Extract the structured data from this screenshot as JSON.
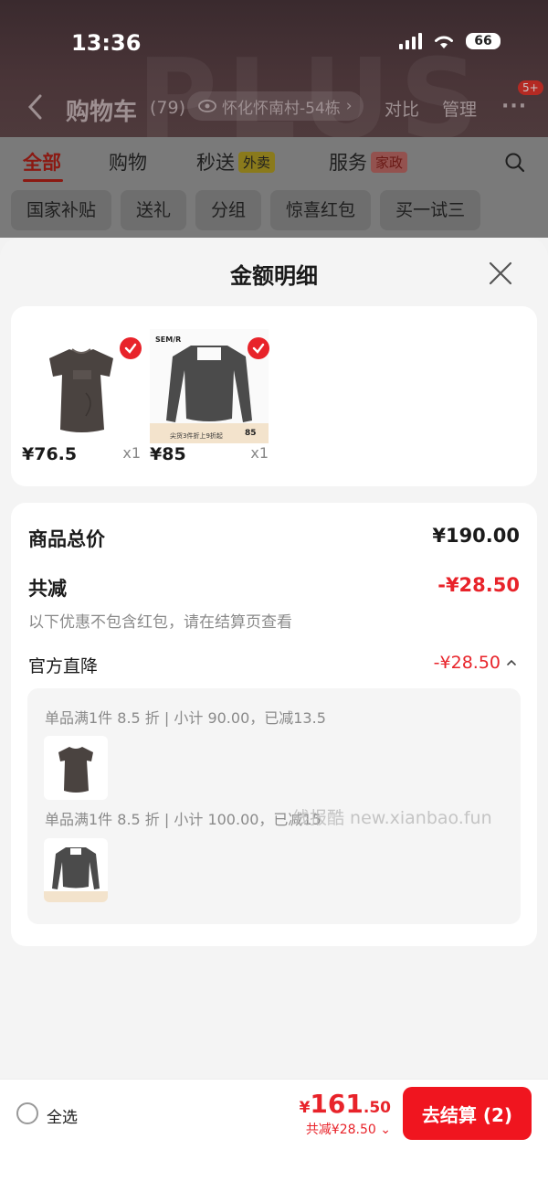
{
  "status_bar": {
    "time": "13:36",
    "battery": "66"
  },
  "header": {
    "title": "购物车",
    "count": "(79)",
    "location": "怀化怀南村-54栋",
    "compare": "对比",
    "manage": "管理",
    "badge": "5+"
  },
  "tabs": [
    {
      "label": "全部"
    },
    {
      "label": "购物"
    },
    {
      "label": "秒送",
      "tag": "外卖"
    },
    {
      "label": "服务",
      "tag": "家政"
    }
  ],
  "filters": [
    "国家补贴",
    "送礼",
    "分组",
    "惊喜红包",
    "买一试三"
  ],
  "sheet": {
    "title": "金额明细",
    "products": [
      {
        "price": "¥76.5",
        "qty": "x1",
        "brand": ""
      },
      {
        "price": "¥85",
        "qty": "x1",
        "brand": "SEM/R",
        "banner_text": "尖货3件折上9折起",
        "banner_price": "85"
      }
    ],
    "subtotal_label": "商品总价",
    "subtotal_value": "¥190.00",
    "discount_label": "共减",
    "discount_value": "-¥28.50",
    "discount_note": "以下优惠不包含红包，请在结算页查看",
    "official_label": "官方直降",
    "official_value": "-¥28.50",
    "promos": [
      "单品满1件 8.5 折 | 小计 90.00，已减13.5",
      "单品满1件 8.5 折 | 小计 100.00，已减15"
    ],
    "watermark": "线报酷 new.xianbao.fun"
  },
  "bottom_bar": {
    "select_all": "全选",
    "total_symbol": "¥",
    "total_int": "161",
    "total_dec": ".50",
    "total_saved": "共减¥28.50",
    "checkout": "去结算 (2)"
  },
  "colors": {
    "accent": "#e8232a",
    "checkout": "#f0151f"
  }
}
